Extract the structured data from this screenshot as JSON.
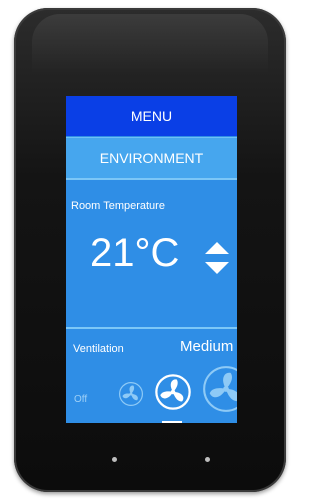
{
  "menu": {
    "title": "MENU"
  },
  "section": {
    "title": "ENVIRONMENT"
  },
  "room_temperature": {
    "label": "Room Temperature",
    "value": "21°C"
  },
  "ventilation": {
    "label": "Ventilation",
    "value": "Medium",
    "off_label": "Off",
    "levels": [
      "low",
      "medium",
      "high"
    ],
    "selected_level": "medium"
  },
  "colors": {
    "screen": "#2f8ee6",
    "menu_bar": "#0a3fe6",
    "section_bar": "#46a6ee",
    "device": "#141414"
  }
}
